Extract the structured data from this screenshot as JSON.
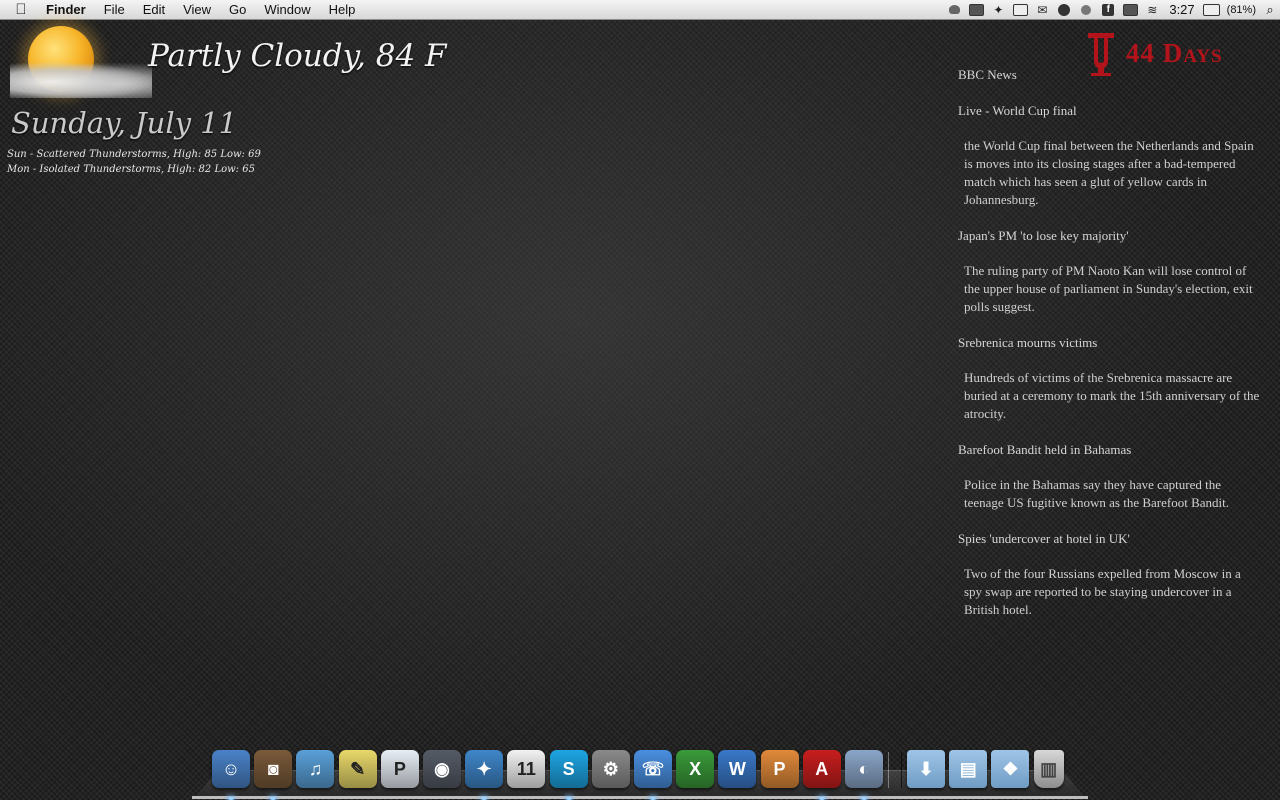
{
  "menubar": {
    "apple_icon": "apple-icon",
    "app_name": "Finder",
    "menus": [
      "File",
      "Edit",
      "View",
      "Go",
      "Window",
      "Help"
    ],
    "status_icons": [
      "growl-icon",
      "terminal-icon",
      "dropbox-icon",
      "calendar-icon",
      "mail-icon",
      "soccer-icon",
      "istat-icon",
      "facebook-icon",
      "display-icon",
      "wifi-icon"
    ],
    "clock": "3:27",
    "battery_percent": "(81%)",
    "spotlight_icon": "spotlight-icon"
  },
  "weather": {
    "condition": "Partly Cloudy, 84 F",
    "date": "Sunday,  July 11",
    "forecast": [
      "Sun - Scattered Thunderstorms, High: 85 Low: 69",
      "Mon - Isolated Thunderstorms, High: 82 Low: 65"
    ],
    "icon": "partly-cloudy-icon"
  },
  "countdown": {
    "logo": "indiana-university-logo",
    "text": "44 Days",
    "color": "#b3141c"
  },
  "news": {
    "source": "BBC News",
    "items": [
      {
        "headline": "Live - World Cup final",
        "summary": "the World Cup final between the Netherlands and Spain is moves into its closing stages after a bad-tempered match which has seen a glut of yellow cards in Johannesburg."
      },
      {
        "headline": "Japan's PM 'to lose key majority'",
        "summary": "The ruling party of PM Naoto Kan will lose control of the upper house of parliament in Sunday's election, exit polls suggest."
      },
      {
        "headline": "Srebrenica mourns victims",
        "summary": "Hundreds of victims of the Srebrenica massacre are buried at a ceremony to mark the 15th anniversary of the atrocity."
      },
      {
        "headline": "Barefoot Bandit held in Bahamas",
        "summary": "Police in the Bahamas say they have captured the teenage US fugitive known as the Barefoot Bandit."
      },
      {
        "headline": "Spies 'undercover at hotel in UK'",
        "summary": "Two of the four Russians expelled from Moscow in a spy swap are reported to be staying undercover in a British hotel."
      }
    ]
  },
  "dock": {
    "apps": [
      {
        "name": "finder-icon",
        "glyph": "☺",
        "color": "#4a82c8",
        "running": true
      },
      {
        "name": "iphoto-icon",
        "glyph": "◙",
        "color": "#7a5a3a",
        "running": true
      },
      {
        "name": "itunes-icon",
        "glyph": "♫",
        "color": "#5aa0d8",
        "running": false
      },
      {
        "name": "stickies-icon",
        "glyph": "✎",
        "color": "#e8d86a",
        "running": false
      },
      {
        "name": "pages-icon",
        "glyph": "P",
        "color": "#e8eef6",
        "running": false
      },
      {
        "name": "steam-icon",
        "glyph": "◉",
        "color": "#555b66",
        "running": false
      },
      {
        "name": "safari-icon",
        "glyph": "✦",
        "color": "#3f86c9",
        "running": true
      },
      {
        "name": "ical-icon",
        "glyph": "11",
        "color": "#f2f2f2",
        "running": false
      },
      {
        "name": "skype-icon",
        "glyph": "S",
        "color": "#1ea5e3",
        "running": true
      },
      {
        "name": "system-preferences-icon",
        "glyph": "⚙",
        "color": "#8a8a8a",
        "running": false
      },
      {
        "name": "ichat-icon",
        "glyph": "☏",
        "color": "#4a8fe0",
        "running": true
      },
      {
        "name": "excel-icon",
        "glyph": "X",
        "color": "#3a9a3a",
        "running": false
      },
      {
        "name": "word-icon",
        "glyph": "W",
        "color": "#3a78c8",
        "running": false
      },
      {
        "name": "powerpoint-icon",
        "glyph": "P",
        "color": "#e08a3a",
        "running": false
      },
      {
        "name": "adobe-reader-icon",
        "glyph": "A",
        "color": "#c81e1e",
        "running": true
      },
      {
        "name": "preview-icon",
        "glyph": "◐",
        "color": "#8aa6c8",
        "running": true
      }
    ],
    "folders": [
      {
        "name": "downloads-folder-icon",
        "glyph": "⬇",
        "color": "#85b2d8"
      },
      {
        "name": "documents-folder-icon",
        "glyph": "▤",
        "color": "#85b2d8"
      },
      {
        "name": "dropbox-folder-icon",
        "glyph": "❖",
        "color": "#85b2d8"
      }
    ],
    "trash": {
      "name": "trash-icon",
      "glyph": "▥"
    }
  }
}
